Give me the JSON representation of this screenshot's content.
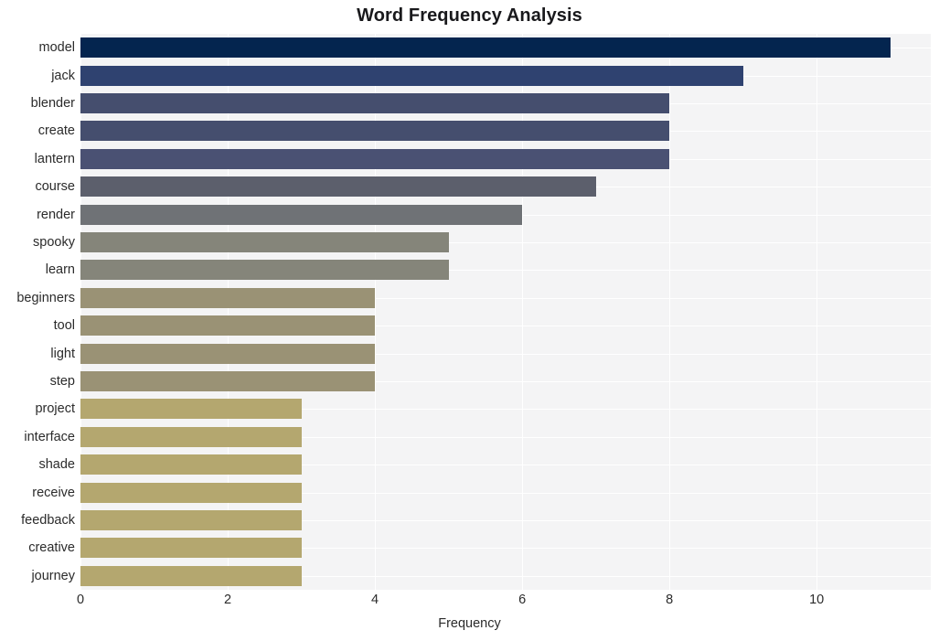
{
  "chart_data": {
    "type": "bar",
    "orientation": "horizontal",
    "title": "Word Frequency Analysis",
    "xlabel": "Frequency",
    "ylabel": "",
    "categories": [
      "model",
      "jack",
      "blender",
      "create",
      "lantern",
      "course",
      "render",
      "spooky",
      "learn",
      "beginners",
      "tool",
      "light",
      "step",
      "project",
      "interface",
      "shade",
      "receive",
      "feedback",
      "creative",
      "journey"
    ],
    "values": [
      11,
      9,
      8,
      8,
      8,
      7,
      6,
      5,
      5,
      4,
      4,
      4,
      4,
      3,
      3,
      3,
      3,
      3,
      3,
      3
    ],
    "bar_colors": [
      "#04254f",
      "#2f4270",
      "#454e6e",
      "#454e6e",
      "#4a5173",
      "#5c5f6c",
      "#6f7276",
      "#85857a",
      "#85857a",
      "#9a9275",
      "#9a9275",
      "#9a9275",
      "#9a9275",
      "#b4a76f",
      "#b4a76f",
      "#b4a76f",
      "#b4a76f",
      "#b4a76f",
      "#b4a76f",
      "#b4a76f"
    ],
    "xlim": [
      0,
      11.55
    ],
    "xticks": [
      0,
      2,
      4,
      6,
      8,
      10
    ],
    "xtick_labels": [
      "0",
      "2",
      "4",
      "6",
      "8",
      "10"
    ],
    "grid": true,
    "grid_color": "#ffffff",
    "plot_background": "#f4f4f5",
    "figure_background": "#ffffff",
    "legend": null,
    "colormap": "cividis_r"
  }
}
